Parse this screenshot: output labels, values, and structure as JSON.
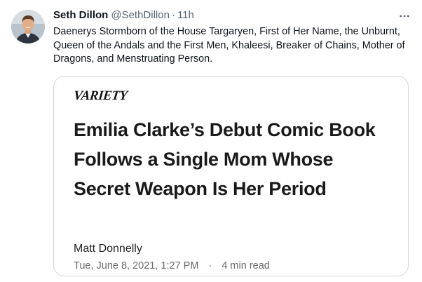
{
  "tweet": {
    "author": {
      "display_name": "Seth Dillon",
      "handle": "@SethDillon",
      "avatar_icon": "user-photo-avatar"
    },
    "separator": "·",
    "timestamp": "11h",
    "more_icon": "more-horizontal-icon",
    "text": "Daenerys Stormborn of the House Targaryen, First of Her Name, the Unburnt, Queen of the Andals and the First Men, Khaleesi, Breaker of Chains, Mother of Dragons, and Menstruating Person."
  },
  "card": {
    "publication_logo": "VARIETY",
    "headline": "Emilia Clarke’s Debut Comic Book Follows a Single Mom Whose Secret Weapon Is Her Period",
    "author": "Matt Donnelly",
    "date": "Tue, June 8, 2021, 1:27 PM",
    "separator": "·",
    "read_time": "4 min read"
  },
  "colors": {
    "text_primary": "#0f1419",
    "text_secondary": "#536471",
    "card_border": "#cfd9de"
  }
}
